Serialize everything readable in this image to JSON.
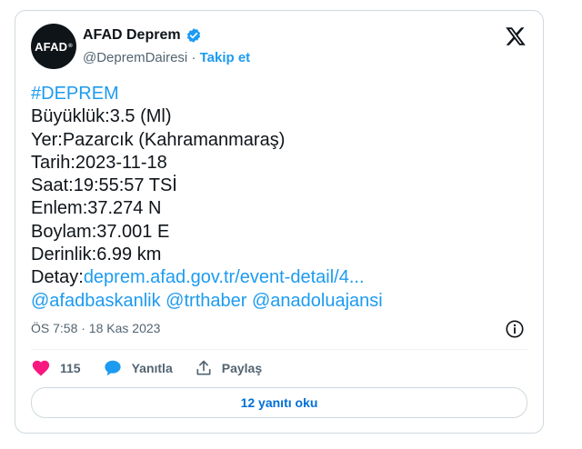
{
  "author": {
    "name": "AFAD Deprem",
    "handle": "@DepremDairesi",
    "separator": "·",
    "follow_label": "Takip et",
    "avatar_text": "AFAD",
    "avatar_mark": "®"
  },
  "tweet": {
    "hashtag": "#DEPREM",
    "magnitude": "Büyüklük:3.5 (Ml)",
    "location": "Yer:Pazarcık (Kahramanmaraş)",
    "date": "Tarih:2023-11-18",
    "time": "Saat:19:55:57 TSİ",
    "latitude": "Enlem:37.274 N",
    "longitude": "Boylam:37.001 E",
    "depth": "Derinlik:6.99 km",
    "detail_label": "Detay:",
    "detail_link": "deprem.afad.gov.tr/event-detail/4...",
    "mentions": [
      "@afadbaskanlik",
      "@trthaber",
      "@anadoluajansi"
    ]
  },
  "meta": {
    "timestamp": "ÖS 7:58 · 18 Kas 2023"
  },
  "actions": {
    "like_count": "115",
    "reply_label": "Yanıtla",
    "share_label": "Paylaş"
  },
  "read_replies_label": "12 yanıtı oku",
  "icons": {
    "like": "heart-icon",
    "reply": "speech-bubble-icon",
    "share": "share-upload-icon",
    "info": "info-icon",
    "brand": "x-logo-icon",
    "verified": "verified-badge-icon"
  },
  "colors": {
    "accent": "#1d9bf0",
    "like": "#f91880",
    "text": "#0f1419",
    "muted": "#536471"
  }
}
